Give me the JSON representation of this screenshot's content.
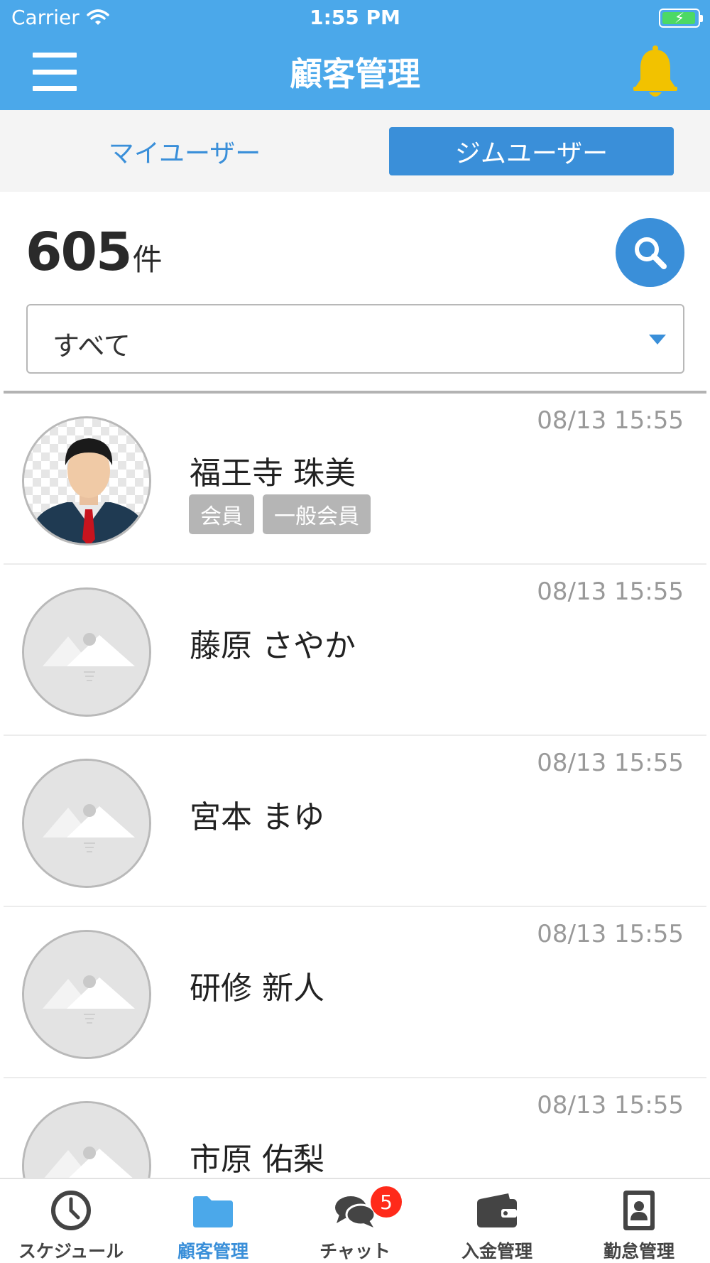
{
  "status_bar": {
    "carrier": "Carrier",
    "time": "1:55 PM"
  },
  "header": {
    "title": "顧客管理"
  },
  "tabs": {
    "my_users": "マイユーザー",
    "gym_users": "ジムユーザー",
    "active": "gym_users"
  },
  "summary": {
    "count": "605",
    "unit": "件"
  },
  "filter": {
    "selected": "すべて"
  },
  "customers": [
    {
      "name": "福王寺 珠美",
      "time": "08/13 15:55",
      "tags": [
        "会員",
        "一般会員"
      ],
      "avatar": "person-photo"
    },
    {
      "name": "藤原 さやか",
      "time": "08/13 15:55",
      "tags": [],
      "avatar": "placeholder"
    },
    {
      "name": "宮本 まゆ",
      "time": "08/13 15:55",
      "tags": [],
      "avatar": "placeholder"
    },
    {
      "name": "研修 新人",
      "time": "08/13 15:55",
      "tags": [],
      "avatar": "placeholder"
    },
    {
      "name": "市原 佑梨",
      "time": "08/13 15:55",
      "tags": [],
      "avatar": "placeholder"
    }
  ],
  "tabbar": {
    "items": [
      {
        "label": "スケジュール",
        "icon": "clock-icon"
      },
      {
        "label": "顧客管理",
        "icon": "folder-icon",
        "active": true
      },
      {
        "label": "チャット",
        "icon": "chat-icon",
        "badge": "5"
      },
      {
        "label": "入金管理",
        "icon": "wallet-icon"
      },
      {
        "label": "勤怠管理",
        "icon": "id-card-icon"
      }
    ]
  },
  "colors": {
    "header": "#4ba8ea",
    "accent": "#3a8fd9",
    "badge": "#ff2a1a",
    "bell": "#f2c200",
    "tag": "#b5b5b5"
  }
}
